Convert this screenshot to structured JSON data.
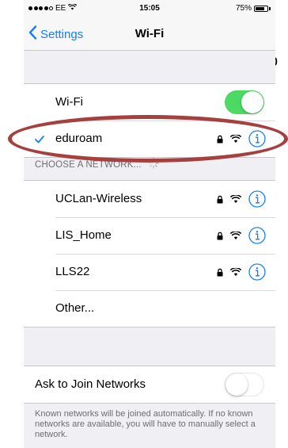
{
  "status_bar": {
    "carrier": "EE",
    "time": "15:05",
    "battery": "75%",
    "battery_level": 0.75
  },
  "nav": {
    "back_label": "Settings",
    "title": "Wi-Fi"
  },
  "stray_text": "p",
  "wifi_row": {
    "label": "Wi-Fi",
    "enabled": true
  },
  "connected_network": {
    "name": "eduroam",
    "secured": true
  },
  "networks_header": "CHOOSE A NETWORK...",
  "networks": [
    {
      "name": "UCLan-Wireless",
      "secured": true
    },
    {
      "name": "LIS_Home",
      "secured": true
    },
    {
      "name": "LLS22",
      "secured": true
    },
    {
      "name": "Other..."
    }
  ],
  "ask_to_join": {
    "label": "Ask to Join Networks",
    "enabled": false
  },
  "footer_note": "Known networks will be joined automatically. If no known networks are available, you will have to manually select a network.",
  "colors": {
    "accent": "#157efb",
    "toggle_on": "#4cd964",
    "highlight": "#a6403e"
  },
  "icons": {
    "check": "checkmark-icon",
    "lock": "lock-icon",
    "wifi": "wifi-signal-icon",
    "info": "info-icon",
    "back": "chevron-left-icon",
    "spinner": "loading-spinner-icon"
  }
}
